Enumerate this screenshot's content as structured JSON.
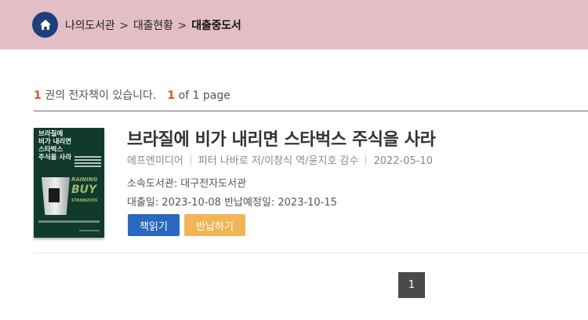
{
  "breadcrumb": {
    "home_icon": "home-icon",
    "items": [
      "나의도서관",
      "대출현황",
      "대출중도서"
    ],
    "separator": ">"
  },
  "summary": {
    "count": "1",
    "count_text": "권의 전자책이 있습니다.",
    "page_current": "1",
    "page_text": "of 1 page"
  },
  "book": {
    "title": "브라질에 비가 내리면 스타벅스 주식을 사라",
    "publisher": "에프엔미디어",
    "authors": "피터 나바로 저/이창식 역/윤지호 감수",
    "pub_date": "2022-05-10",
    "library": "소속도서관: 대구전자도서관",
    "loan_dates": "대출일: 2023-10-08 반납예정일: 2023-10-15",
    "cover": {
      "title_lines": [
        "브라질에",
        "비가 내리면",
        "스타벅스",
        "주식을 사라"
      ],
      "art_text": [
        "RAINING",
        "BUY",
        "STARBUCKS"
      ]
    }
  },
  "actions": {
    "read_label": "책읽기",
    "return_label": "반납하기"
  },
  "pagination": {
    "current": "1"
  },
  "colors": {
    "topbar": "#e3bec6",
    "home": "#1d3f7a",
    "accent_number": "#d2571f",
    "read_button": "#2a68be",
    "return_button": "#efb556",
    "page_active": "#4a4a4a"
  }
}
